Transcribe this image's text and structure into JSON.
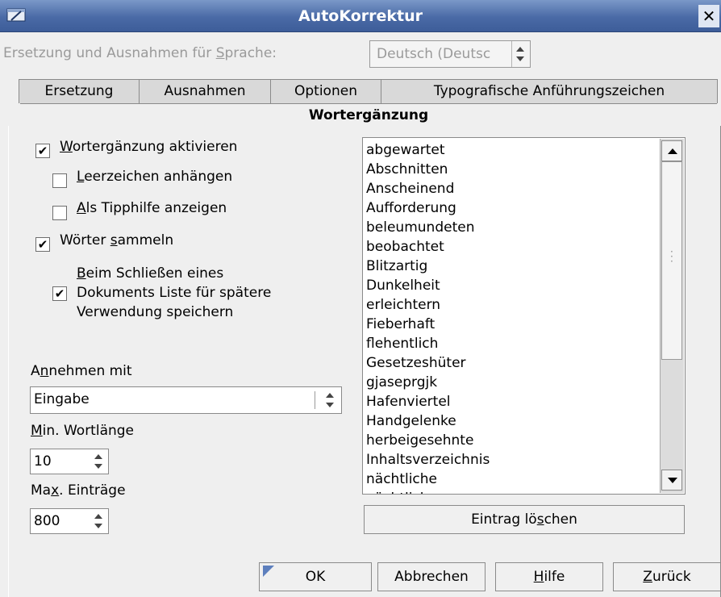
{
  "window": {
    "title": "AutoKorrektur",
    "close_glyph": "✕"
  },
  "language": {
    "label_prefix": "Ersetzung und Ausnahmen für ",
    "label_u": "S",
    "label_suffix": "prache:",
    "value": "Deutsch (Deutsc"
  },
  "tabs": [
    {
      "label": "Ersetzung"
    },
    {
      "label": "Ausnahmen"
    },
    {
      "label": "Optionen"
    },
    {
      "label": "Typografische Anführungszeichen"
    }
  ],
  "active_tab": "Wortergänzung",
  "options": {
    "enable": {
      "u": "W",
      "rest": "ortergänzung aktivieren",
      "checked": true
    },
    "append_space": {
      "u": "L",
      "rest": "eerzeichen anhängen",
      "checked": false
    },
    "show_tip": {
      "u": "A",
      "rest": "ls Tipphilfe anzeigen",
      "checked": false
    },
    "collect": {
      "pre": "Wörter ",
      "u": "s",
      "rest": "ammeln",
      "checked": true
    },
    "keep_list": {
      "line1_u": "B",
      "line1_rest": "eim Schließen eines",
      "line2": "Dokuments Liste für spätere",
      "line3": "Verwendung speichern",
      "checked": true
    }
  },
  "accept_with": {
    "label_pre": "A",
    "label_u": "n",
    "label_rest": "nehmen mit",
    "value": "Eingabe"
  },
  "min_length": {
    "label_u": "M",
    "label_rest": "in. Wortlänge",
    "value": "10"
  },
  "max_entries": {
    "label_pre": "Ma",
    "label_u": "x",
    "label_rest": ". Einträge",
    "value": "800"
  },
  "words": [
    "abgewartet",
    "Abschnitten",
    "Anscheinend",
    "Aufforderung",
    "beleumundeten",
    "beobachtet",
    "Blitzartig",
    "Dunkelheit",
    "erleichtern",
    "Fieberhaft",
    "flehentlich",
    "Gesetzeshüter",
    "gjaseprgjk",
    "Hafenviertel",
    "Handgelenke",
    "herbeigesehnte",
    "Inhaltsverzeichnis",
    "nächtliche",
    "nächtlich"
  ],
  "delete_button": {
    "pre": "Eintrag lö",
    "u": "s",
    "rest": "chen"
  },
  "footer": {
    "ok": "OK",
    "cancel": "Abbrechen",
    "help_u": "H",
    "help_rest": "ilfe",
    "back_u": "Z",
    "back_rest": "urück"
  },
  "icons": {
    "app": "window-menu-icon",
    "check": "✔"
  }
}
